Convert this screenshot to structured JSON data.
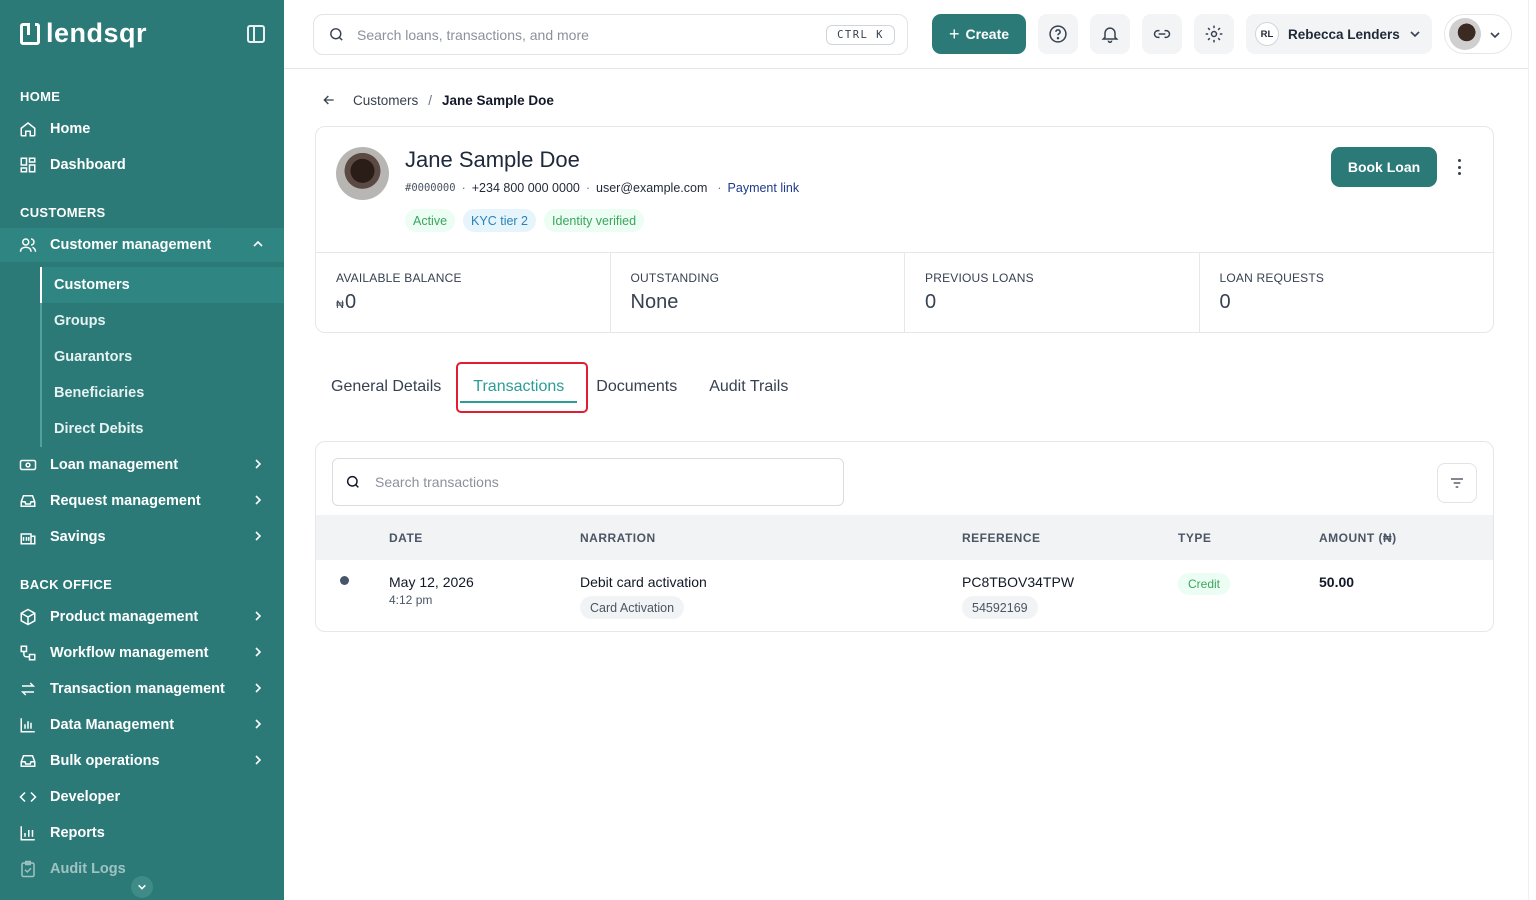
{
  "app": {
    "logo_text": "lendsqr"
  },
  "sidebar": {
    "sections": {
      "home": "HOME",
      "customers": "CUSTOMERS",
      "back_office": "BACK OFFICE"
    },
    "home_items": [
      {
        "label": "Home",
        "icon": "home-icon"
      },
      {
        "label": "Dashboard",
        "icon": "dashboard-grid-icon"
      }
    ],
    "customer_management": {
      "label": "Customer management",
      "icon": "users-icon",
      "expanded": true
    },
    "customer_sub_items": [
      {
        "label": "Customers",
        "current": true
      },
      {
        "label": "Groups"
      },
      {
        "label": "Guarantors"
      },
      {
        "label": "Beneficiaries"
      },
      {
        "label": "Direct Debits"
      }
    ],
    "customer_items": [
      {
        "label": "Loan management",
        "icon": "cash-icon"
      },
      {
        "label": "Request management",
        "icon": "inbox-icon"
      },
      {
        "label": "Savings",
        "icon": "bank-icon"
      }
    ],
    "back_office_items": [
      {
        "label": "Product management",
        "icon": "box-icon"
      },
      {
        "label": "Workflow management",
        "icon": "workflow-icon"
      },
      {
        "label": "Transaction management",
        "icon": "transfer-arrows-icon"
      },
      {
        "label": "Data Management",
        "icon": "bar-chart-icon"
      },
      {
        "label": "Bulk operations",
        "icon": "inbox-icon"
      },
      {
        "label": "Developer",
        "icon": "code-icon"
      },
      {
        "label": "Reports",
        "icon": "reports-icon"
      },
      {
        "label": "Audit Logs",
        "icon": "clipboard-icon"
      }
    ]
  },
  "topbar": {
    "search_placeholder": "Search loans, transactions, and more",
    "search_shortcut": "CTRL K",
    "create_label": "Create",
    "user_initials": "RL",
    "user_name": "Rebecca Lenders"
  },
  "breadcrumb": {
    "parent": "Customers",
    "separator": "/",
    "current": "Jane Sample Doe"
  },
  "customer": {
    "name": "Jane Sample Doe",
    "id": "#0000000",
    "phone": "+234 800 000 0000",
    "email": "user@example.com",
    "payment_link_label": "Payment link",
    "badges": [
      {
        "label": "Active",
        "color": "green"
      },
      {
        "label": "KYC tier 2",
        "color": "blue"
      },
      {
        "label": "Identity verified",
        "color": "green"
      }
    ],
    "book_loan_label": "Book Loan"
  },
  "stats": [
    {
      "label": "AVAILABLE BALANCE",
      "currency": "₦",
      "value": "0"
    },
    {
      "label": "OUTSTANDING",
      "currency": "",
      "value": "None"
    },
    {
      "label": "PREVIOUS LOANS",
      "currency": "",
      "value": "0"
    },
    {
      "label": "LOAN REQUESTS",
      "currency": "",
      "value": "0"
    }
  ],
  "tabs": [
    {
      "label": "General Details",
      "active": false
    },
    {
      "label": "Transactions",
      "active": true
    },
    {
      "label": "Documents",
      "active": false
    },
    {
      "label": "Audit Trails",
      "active": false
    }
  ],
  "transactions": {
    "search_placeholder": "Search transactions",
    "columns": [
      "DATE",
      "NARRATION",
      "REFERENCE",
      "TYPE",
      "AMOUNT (₦)"
    ],
    "rows": [
      {
        "date": "May 12, 2026",
        "time": "4:12 pm",
        "narration": "Debit card activation",
        "narration_tag": "Card Activation",
        "reference": "PC8TBOV34TPW",
        "reference_sub": "54592169",
        "type": "Credit",
        "amount": "50.00"
      }
    ]
  },
  "colors": {
    "brand": "#2b7a78",
    "accent_tab": "#2b9c96",
    "highlight": "#e11d2f",
    "credit": "#3ba55c"
  }
}
